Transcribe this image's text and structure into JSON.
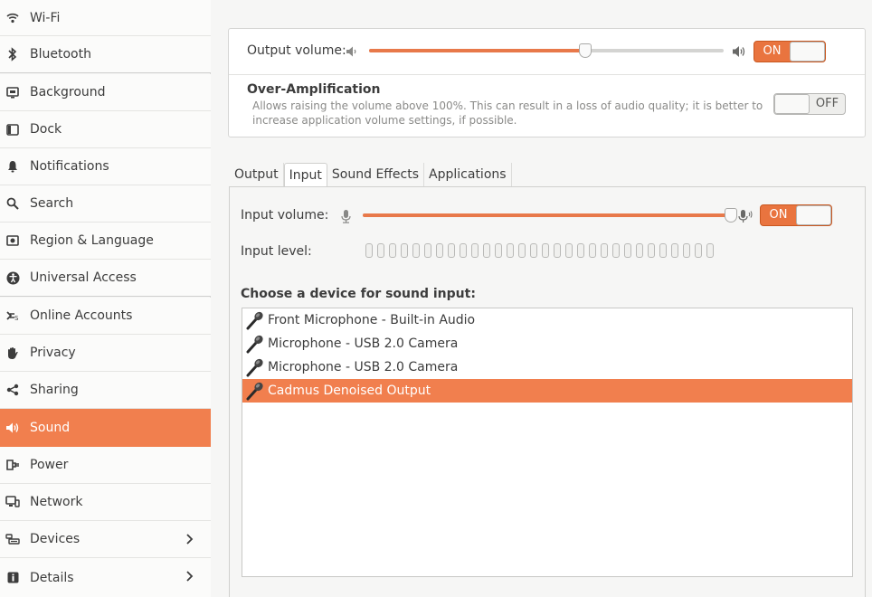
{
  "sidebar": {
    "items": [
      {
        "label": "Wi-Fi",
        "icon": "wifi-icon"
      },
      {
        "label": "Bluetooth",
        "icon": "bluetooth-icon"
      },
      {
        "label": "Background",
        "icon": "background-icon"
      },
      {
        "label": "Dock",
        "icon": "dock-icon"
      },
      {
        "label": "Notifications",
        "icon": "bell-icon"
      },
      {
        "label": "Search",
        "icon": "search-icon"
      },
      {
        "label": "Region & Language",
        "icon": "region-icon"
      },
      {
        "label": "Universal Access",
        "icon": "universal-access-icon"
      },
      {
        "label": "Online Accounts",
        "icon": "online-accounts-icon"
      },
      {
        "label": "Privacy",
        "icon": "privacy-hand-icon"
      },
      {
        "label": "Sharing",
        "icon": "share-icon"
      },
      {
        "label": "Sound",
        "icon": "speaker-icon",
        "active": true
      },
      {
        "label": "Power",
        "icon": "power-plug-icon"
      },
      {
        "label": "Network",
        "icon": "network-icon"
      },
      {
        "label": "Devices",
        "icon": "devices-icon",
        "chevron": true
      },
      {
        "label": "Details",
        "icon": "details-icon",
        "chevron": true
      }
    ]
  },
  "output": {
    "volume_label": "Output volume:",
    "volume_level": 0.61,
    "switch_state": "ON",
    "over_amp_title": "Over-Amplification",
    "over_amp_desc_line1": "Allows raising the volume above 100%. This can result in a loss of audio quality; it is better to",
    "over_amp_desc_line2": "increase application volume settings, if possible.",
    "over_amp_switch": "OFF"
  },
  "tabs": [
    {
      "label": "Output"
    },
    {
      "label": "Input",
      "active": true
    },
    {
      "label": "Sound Effects"
    },
    {
      "label": "Applications"
    }
  ],
  "input": {
    "volume_label": "Input volume:",
    "volume_level": 1.0,
    "switch_state": "ON",
    "level_label": "Input level:",
    "level_value": 0,
    "choose_label": "Choose a device for sound input:",
    "devices": [
      {
        "label": "Front Microphone - Built-in Audio"
      },
      {
        "label": "Microphone - USB 2.0 Camera"
      },
      {
        "label": "Microphone - USB 2.0 Camera"
      },
      {
        "label": "Cadmus Denoised Output",
        "selected": true
      }
    ]
  },
  "colors": {
    "accent": "#f17f4e"
  }
}
